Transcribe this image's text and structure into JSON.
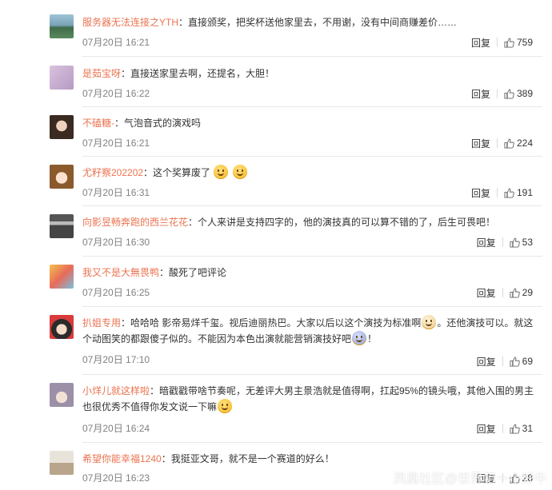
{
  "watermark": "凤凰社区@世界第一小好牛",
  "comments": [
    {
      "user": "服务器无法连接之YTH",
      "text": "：直接颁奖，把奖杯送他家里去，不用谢，没有中间商赚差价……",
      "time": "07月20日 16:21",
      "reply": "回复",
      "likes": "759",
      "avatar": "landscape-avatar"
    },
    {
      "user": "是茹宝呀",
      "text": "：直接送家里去啊，还提名，大胆！",
      "time": "07月20日 16:22",
      "reply": "回复",
      "likes": "389",
      "avatar": "purple-avatar"
    },
    {
      "user": "不磕糖-",
      "text": "：气泡音式的演戏吗",
      "time": "07月20日 16:21",
      "reply": "回复",
      "likes": "224",
      "avatar": "girl-avatar"
    },
    {
      "user": "尤籽察202202",
      "text": "：这个奖算废了",
      "time": "07月20日 16:31",
      "reply": "回复",
      "likes": "191",
      "avatar": "anime-avatar"
    },
    {
      "user": "向影昱畅奔跑的西兰花花",
      "text": "：个人来讲是支持四字的，他的演技真的可以算不错的了，后生可畏吧！",
      "time": "07月20日 16:30",
      "reply": "回复",
      "likes": "53",
      "avatar": "ninja-avatar"
    },
    {
      "user": "我又不是大無畏鸭",
      "text": "：酸死了吧评论",
      "time": "07月20日 16:25",
      "reply": "回复",
      "likes": "29",
      "avatar": "colorful-avatar"
    },
    {
      "user": "扒姐专用",
      "text_line1": "：哈哈哈 影帝易烊千玺。视后迪丽热巴。大家以后以这个演技为标准啊",
      "text_line1b": "。还他演技可以。就这",
      "text_line2": "个动图笑的都跟傻子似的。不能因为本色出演就能营销演技好吧",
      "text_line2b": "！",
      "time": "07月20日 17:10",
      "reply": "回复",
      "likes": "69",
      "avatar": "kiki-avatar"
    },
    {
      "user": "小烊儿就这样啦",
      "text_line1": "：暗戳戳带啥节奏呢，无差评大男主景浩就是值得啊，扛起95%的镜头哦，其他入围的男主",
      "text_line2": "也很优秀不值得你发文说一下嘛",
      "time": "07月20日 16:24",
      "reply": "回复",
      "likes": "31",
      "avatar": "boy-avatar"
    },
    {
      "user": "希望你能幸福1240",
      "text": "：我挺亚文哥，就不是一个赛道的好么！",
      "time": "07月20日 16:23",
      "reply": "回复",
      "likes": "28",
      "avatar": "room-avatar"
    }
  ]
}
